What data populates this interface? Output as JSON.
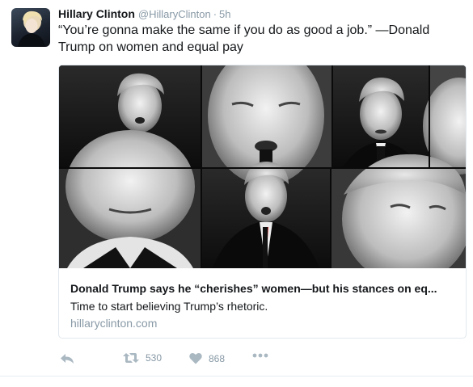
{
  "tweet": {
    "author_name": "Hillary Clinton",
    "handle": "@HillaryClinton",
    "separator": "·",
    "time": "5h",
    "text": "“You’re gonna make the same if you do as good a job.” —Donald Trump on women and equal pay"
  },
  "card": {
    "title": "Donald Trump says he “cherishes” women—but his stances on eq...",
    "description": "Time to start believing Trump’s rhetoric.",
    "domain": "hillaryclinton.com"
  },
  "actions": {
    "reply_icon": "reply-icon",
    "retweet_icon": "retweet-icon",
    "retweet_count": "530",
    "like_icon": "heart-icon",
    "like_count": "868",
    "more_icon": "more-dots-icon"
  },
  "colors": {
    "text": "#14171a",
    "muted": "#8899a6",
    "icon": "#aab8c2",
    "border": "#e1e8ed"
  }
}
